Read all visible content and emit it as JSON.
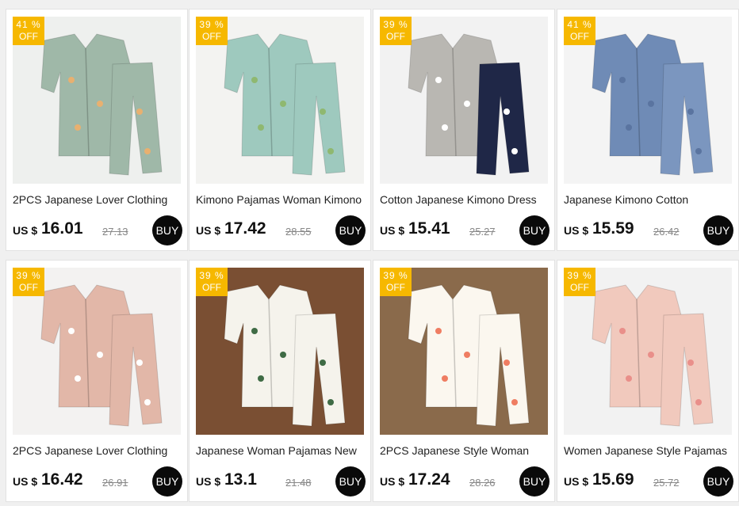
{
  "colors": {
    "badge": "#f6b800",
    "buy_button": "#0a0a0a",
    "card_bg": "#ffffff",
    "page_bg": "#f0f0f0"
  },
  "products": [
    {
      "discount": "41 %",
      "off": "OFF",
      "title": "2PCS Japanese Lover Clothing",
      "currency": "US $",
      "price": "16.01",
      "old_price": "27.13",
      "buy": "BUY",
      "image": {
        "bg": "#eef0ee",
        "top": "#9fb8a8",
        "bottom": "#9fb8a8",
        "accent": "#e8b070",
        "icon": "kimono-set-cats"
      }
    },
    {
      "discount": "39 %",
      "off": "OFF",
      "title": "Kimono Pajamas Woman Kimono",
      "currency": "US $",
      "price": "17.42",
      "old_price": "28.55",
      "buy": "BUY",
      "image": {
        "bg": "#f3f3f1",
        "top": "#9ec9be",
        "bottom": "#9ec9be",
        "accent": "#8fb870",
        "icon": "kimono-set-mint"
      }
    },
    {
      "discount": "39 %",
      "off": "OFF",
      "title": "Cotton Japanese Kimono Dress",
      "currency": "US $",
      "price": "15.41",
      "old_price": "25.27",
      "buy": "BUY",
      "image": {
        "bg": "#f2f2f2",
        "top": "#b9b7b2",
        "bottom": "#1f2747",
        "accent": "#ffffff",
        "icon": "kimono-robes"
      }
    },
    {
      "discount": "41 %",
      "off": "OFF",
      "title": "Japanese Kimono Cotton",
      "currency": "US $",
      "price": "15.59",
      "old_price": "26.42",
      "buy": "BUY",
      "image": {
        "bg": "#f4f4f4",
        "top": "#6f8bb6",
        "bottom": "#7b96bf",
        "accent": "#5a74a0",
        "icon": "kimono-set-blue"
      }
    },
    {
      "discount": "39 %",
      "off": "OFF",
      "title": "2PCS Japanese Lover Clothing",
      "currency": "US $",
      "price": "16.42",
      "old_price": "26.91",
      "buy": "BUY",
      "image": {
        "bg": "#f3f2f1",
        "top": "#e2b7a8",
        "bottom": "#e2b7a8",
        "accent": "#ffffff",
        "icon": "kimono-set-pink"
      }
    },
    {
      "discount": "39 %",
      "off": "OFF",
      "title": "Japanese Woman Pajamas New",
      "currency": "US $",
      "price": "13.1",
      "old_price": "21.48",
      "buy": "BUY",
      "image": {
        "bg": "#7a4f33",
        "top": "#f5f3ec",
        "bottom": "#f5f3ec",
        "accent": "#3f6b45",
        "icon": "kimono-robe-leaves"
      }
    },
    {
      "discount": "39 %",
      "off": "OFF",
      "title": "2PCS Japanese Style Woman",
      "currency": "US $",
      "price": "17.24",
      "old_price": "28.26",
      "buy": "BUY",
      "image": {
        "bg": "#8a6a4b",
        "top": "#fbf7ef",
        "bottom": "#fbf7ef",
        "accent": "#ef7d62",
        "icon": "kimono-set-fruit"
      }
    },
    {
      "discount": "39 %",
      "off": "OFF",
      "title": "Women Japanese Style Pajamas",
      "currency": "US $",
      "price": "15.69",
      "old_price": "25.72",
      "buy": "BUY",
      "image": {
        "bg": "#f2f2f2",
        "top": "#f1c9bd",
        "bottom": "#f1c9bd",
        "accent": "#e98f8a",
        "icon": "kimono-set-floral"
      }
    }
  ]
}
